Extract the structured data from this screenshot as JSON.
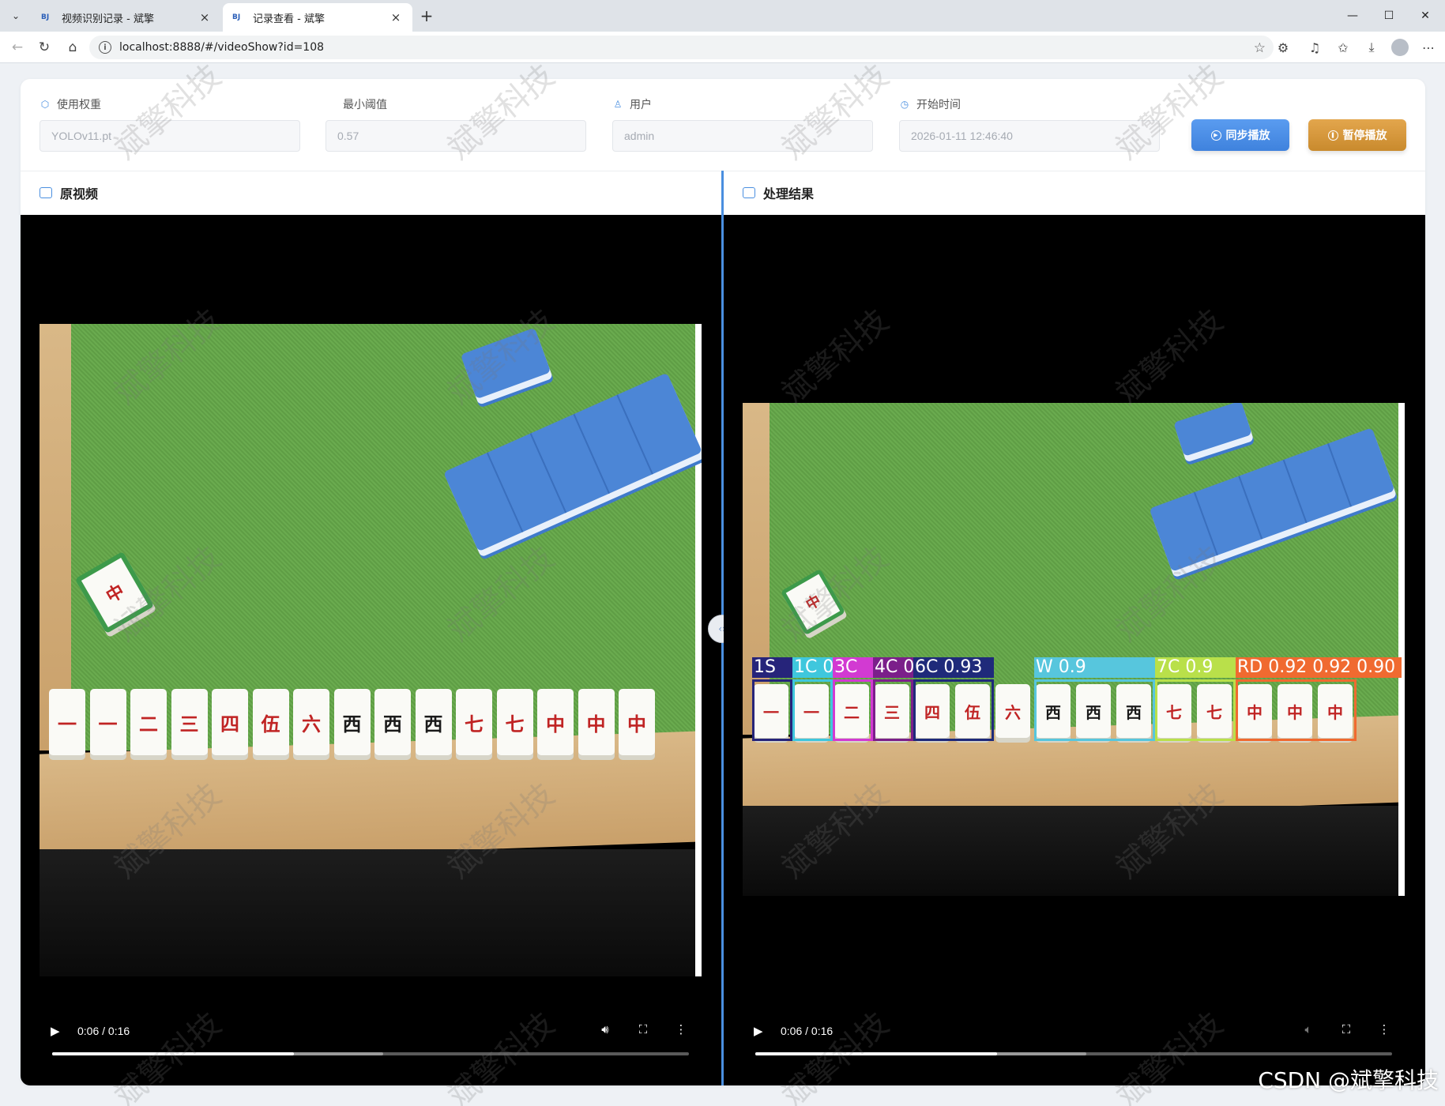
{
  "browser": {
    "tabs": [
      {
        "favicon": "BJ",
        "title": "视频识别记录 - 斌擎",
        "active": false
      },
      {
        "favicon": "BJ",
        "title": "记录查看 - 斌擎",
        "active": true
      }
    ],
    "url": "localhost:8888/#/videoShow?id=108"
  },
  "form": {
    "weight": {
      "label": "使用权重",
      "value": "YOLOv11.pt",
      "icon": "cube-icon"
    },
    "threshold": {
      "label": "最小阈值",
      "value": "0.57"
    },
    "user": {
      "label": "用户",
      "value": "admin",
      "icon": "user-icon"
    },
    "start_time": {
      "label": "开始时间",
      "value": "2026-01-11 12:46:40",
      "icon": "clock-icon"
    }
  },
  "buttons": {
    "sync": "同步播放",
    "pause": "暂停播放"
  },
  "panels": {
    "original": "原视频",
    "result": "处理结果"
  },
  "players": {
    "original": {
      "time": "0:06 / 0:16",
      "played": 0.38,
      "buffered": 0.52
    },
    "result": {
      "time": "0:06 / 0:16",
      "played": 0.38,
      "buffered": 0.52
    }
  },
  "tiles": {
    "original": [
      "一",
      "一",
      "二",
      "三",
      "四",
      "伍",
      "六",
      "西",
      "西",
      "西",
      "七",
      "七",
      "中",
      "中",
      "中"
    ],
    "result": [
      "一",
      "一",
      "二",
      "三",
      "四",
      "伍",
      "六",
      "西",
      "西",
      "西",
      "七",
      "七",
      "中",
      "中",
      "中"
    ]
  },
  "detections": [
    {
      "label": "1S",
      "color": "#26247a"
    },
    {
      "label": "1C 0.92",
      "color": "#3fc7dd"
    },
    {
      "label": "3C",
      "color": "#d23ad2"
    },
    {
      "label": "4C 0.94",
      "color": "#7b1f8a"
    },
    {
      "label": "6C 0.93",
      "color": "#1f2a7a"
    },
    {
      "label": "W 0.9",
      "color": "#57c6dd"
    },
    {
      "label": "7C 0.9",
      "color": "#b9e04a"
    },
    {
      "label": "RD 0.92 0.92 0.90",
      "color": "#f06a30"
    }
  ],
  "watermark": "斌擎科技",
  "footer_credit": "CSDN @斌擎科技"
}
